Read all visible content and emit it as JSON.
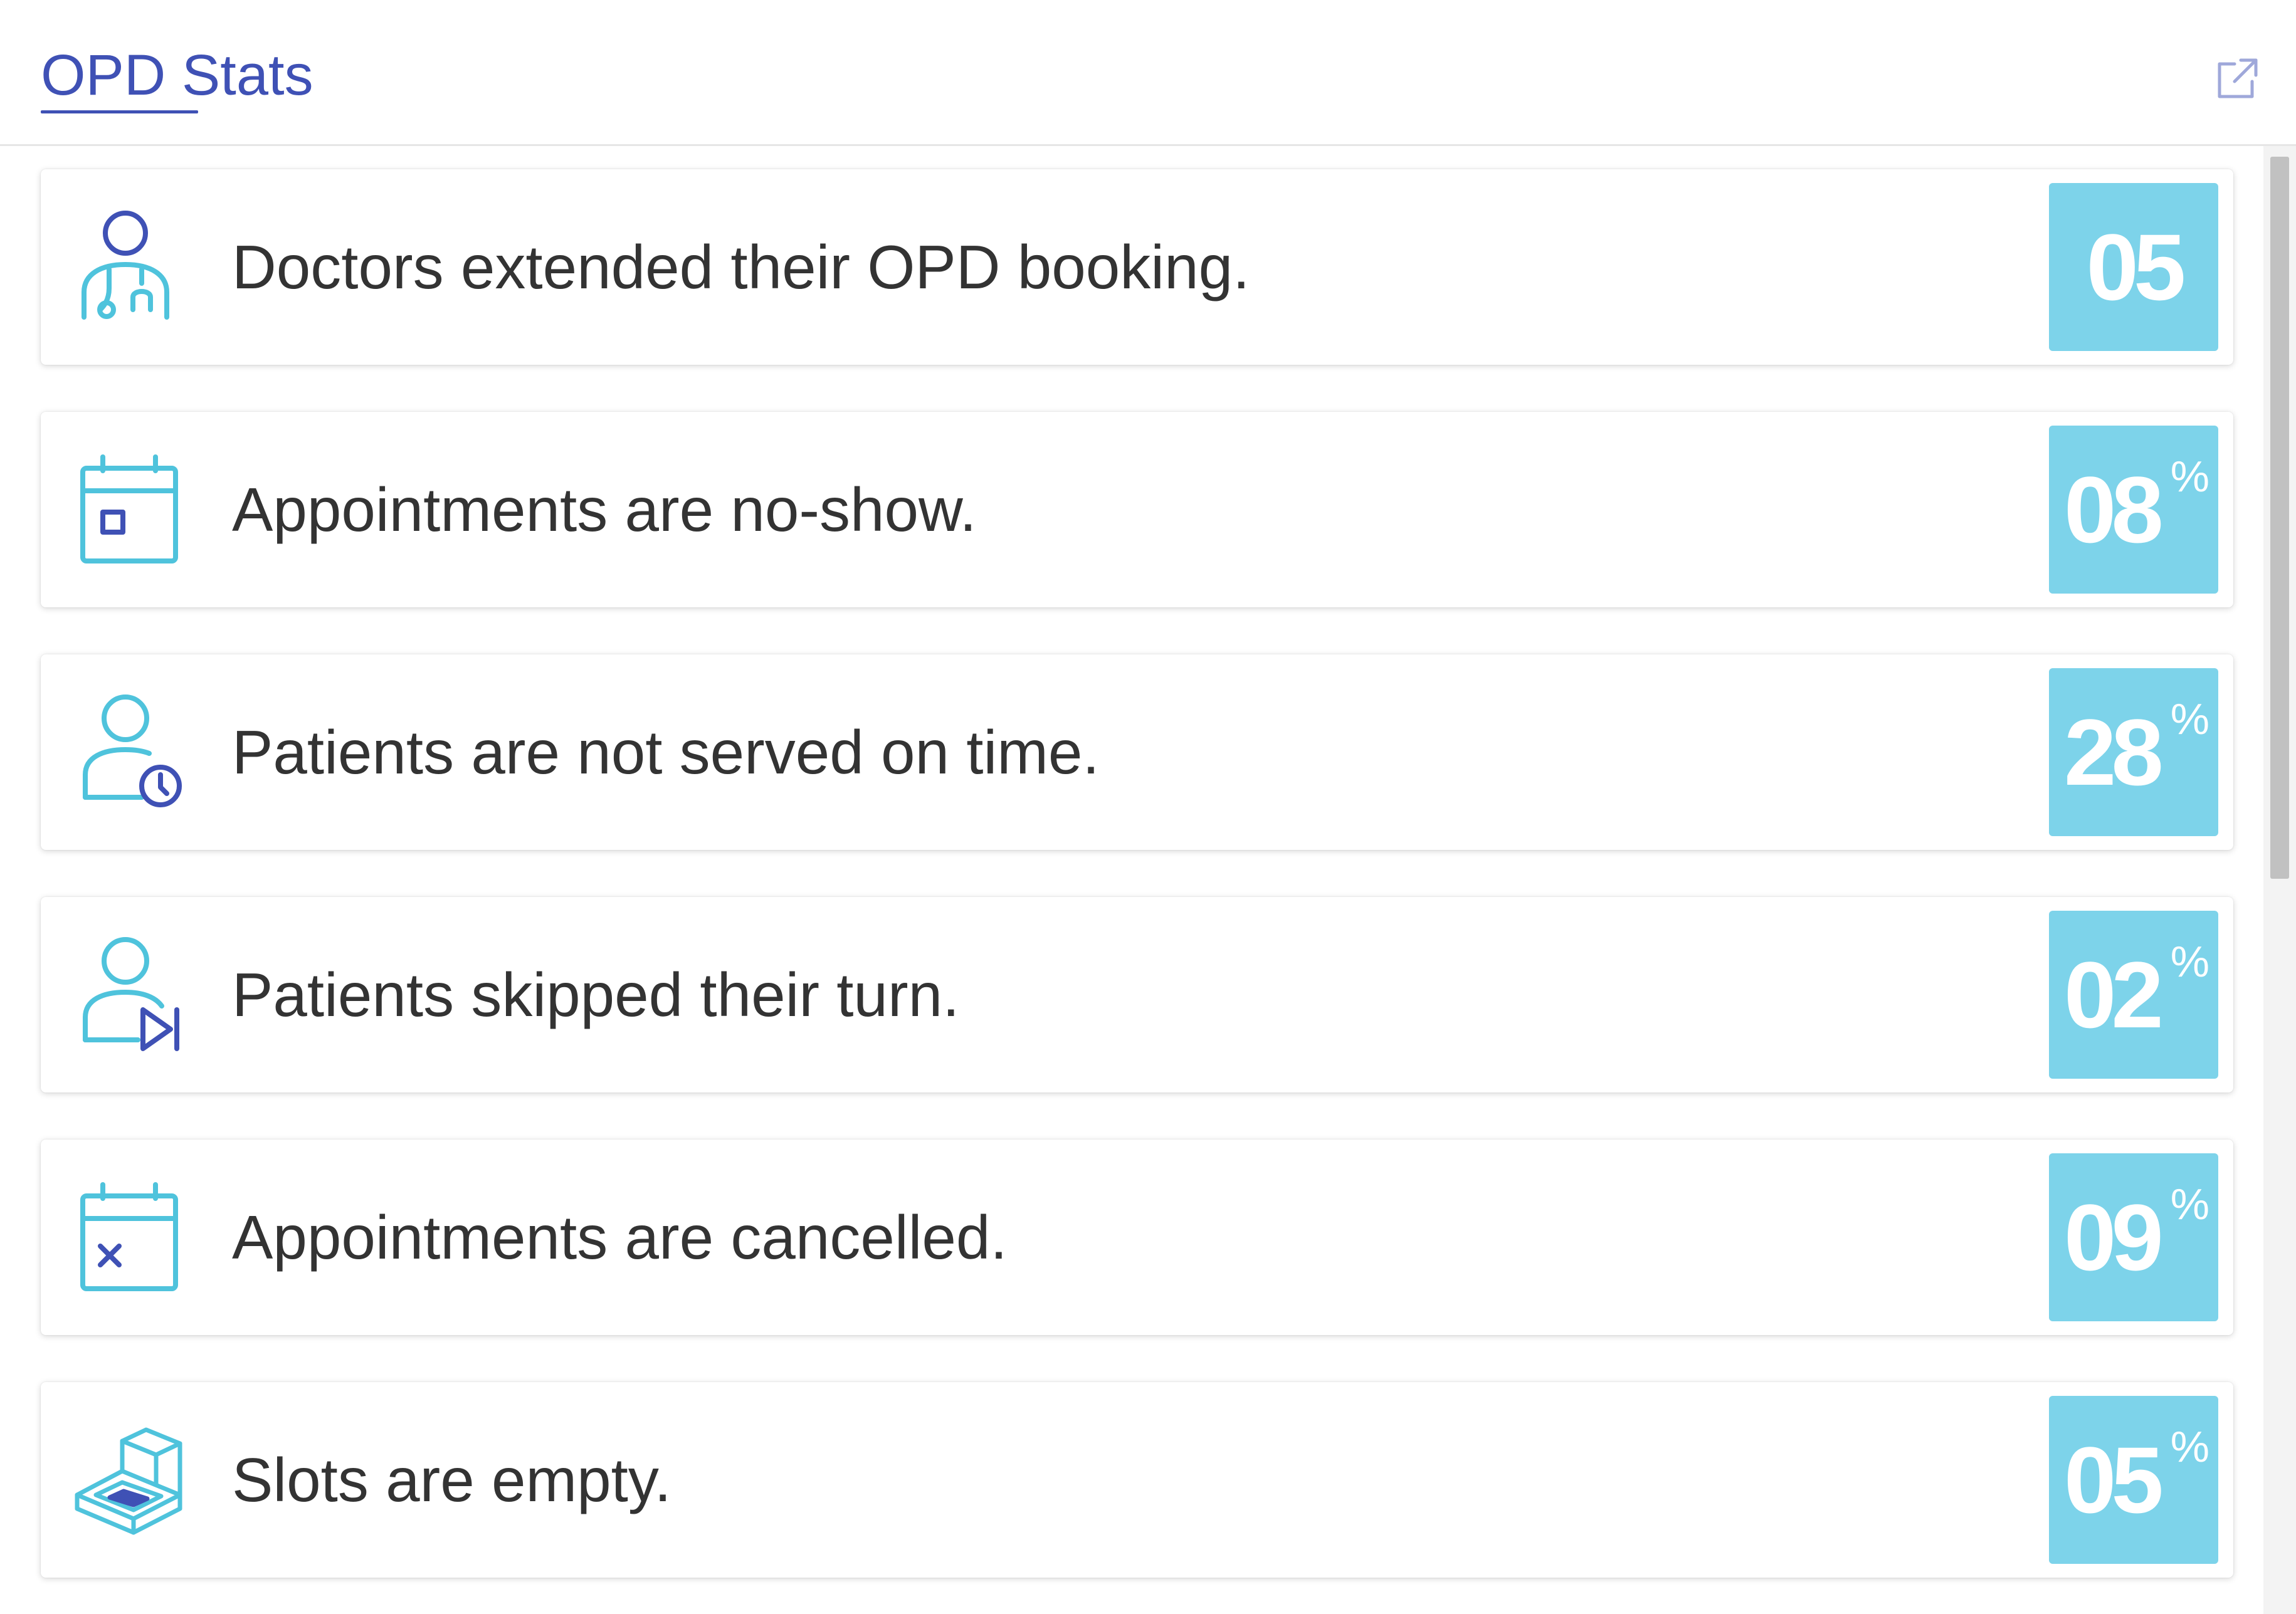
{
  "header": {
    "title": "OPD Stats",
    "external_link_icon": "external-link-icon"
  },
  "colors": {
    "accent": "#3f51b5",
    "icon_teal": "#4fc3dc",
    "value_box": "#7dd3ea",
    "text": "#333333"
  },
  "stats": [
    {
      "icon": "doctor-icon",
      "label": "Doctors extended their OPD booking.",
      "value": "05",
      "unit": ""
    },
    {
      "icon": "calendar-no-show-icon",
      "label": "Appointments are no-show.",
      "value": "08",
      "unit": "%"
    },
    {
      "icon": "patient-clock-icon",
      "label": "Patients are not served on time.",
      "value": "28",
      "unit": "%"
    },
    {
      "icon": "patient-skip-icon",
      "label": "Patients skipped their turn.",
      "value": "02",
      "unit": "%"
    },
    {
      "icon": "calendar-cancel-icon",
      "label": "Appointments are cancelled.",
      "value": "09",
      "unit": "%"
    },
    {
      "icon": "empty-slot-box-icon",
      "label": "Slots are empty.",
      "value": "05",
      "unit": "%"
    }
  ]
}
